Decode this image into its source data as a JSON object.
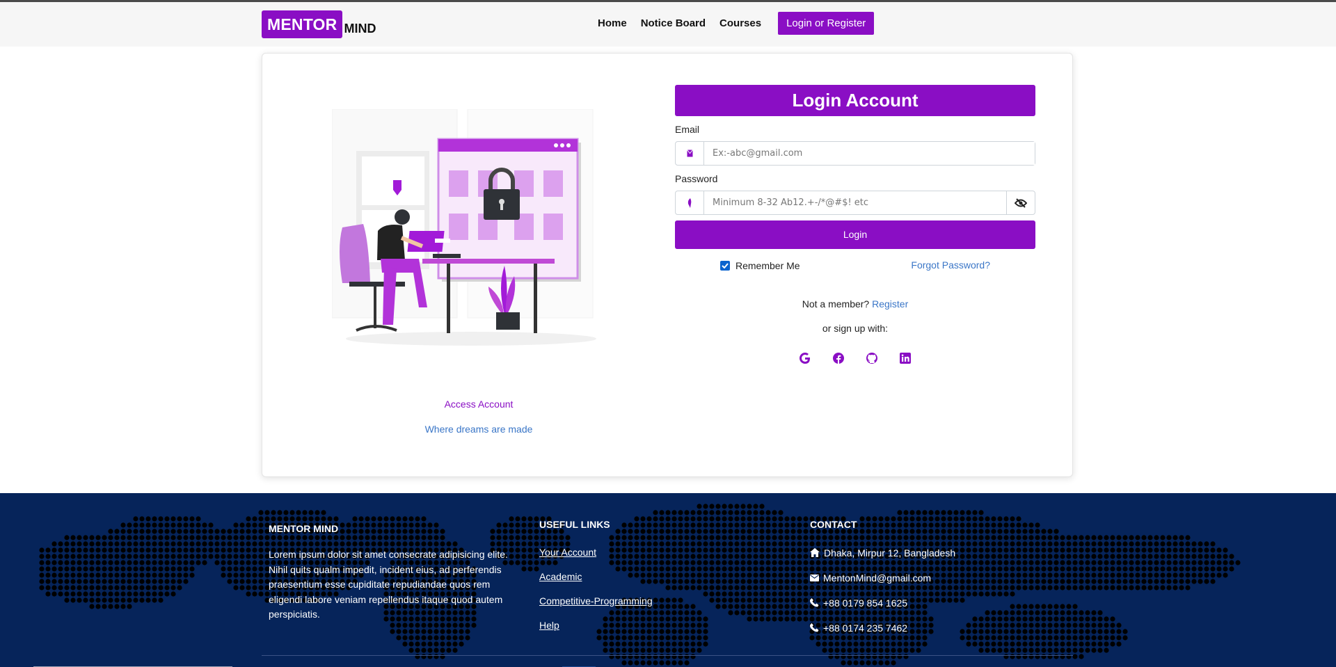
{
  "nav": {
    "logo_box": "MENTOR",
    "logo_rest": "MIND",
    "links": [
      "Home",
      "Notice Board",
      "Courses"
    ],
    "cta": "Login or Register"
  },
  "left": {
    "illustration": "person-at-desk-locked-screen-illustration",
    "title": "Access Account",
    "subtitle": "Where dreams are made"
  },
  "form": {
    "header": "Login Account",
    "email_label": "Email",
    "email_placeholder": "Ex:-abc@gmail.com",
    "email_icon": "envelope-icon",
    "password_label": "Password",
    "password_placeholder": "Minimum 8-32 Ab12.+-/*@#$! etc",
    "password_icon": "key-icon",
    "toggle_icon": "eye-slash-icon",
    "login_button": "Login",
    "remember_me": "Remember Me",
    "remember_checked": true,
    "forgot": "Forgot Password?",
    "not_member": "Not a member?",
    "register": "Register",
    "or_signup": "or sign up with:",
    "socials": [
      "google-icon",
      "facebook-icon",
      "github-icon",
      "linkedin-icon"
    ]
  },
  "footer": {
    "brand": {
      "title": "MENTOR MIND",
      "desc": "Lorem ipsum dolor sit amet consecrate adipisicing elite. Nihil quits qualm impedit, incident eius, ad perferendis praesentium esse cupiditate repudiandae quos rem eligendi labore veniam repellendus itaque quod autem perspiciatis."
    },
    "links": {
      "title": "USEFUL LINKS",
      "items": [
        "Your Account",
        "Academic",
        "Competitive-Programming",
        "Help"
      ]
    },
    "contact": {
      "title": "CONTACT",
      "address": "Dhaka, Mirpur 12, Bangladesh",
      "email": "MentonMind@gmail.com",
      "phone1": "+88 0179 854 1625",
      "phone2": "+88 0174 235 7462"
    }
  },
  "colors": {
    "primary": "#8a0ec4",
    "link": "#3a76c7",
    "footer_bg": "#06245a"
  }
}
